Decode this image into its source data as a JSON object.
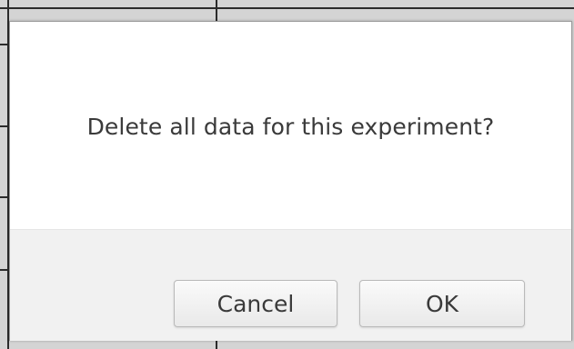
{
  "dialog": {
    "message": "Delete all data for this experiment?",
    "buttons": {
      "cancel_label": "Cancel",
      "ok_label": "OK"
    }
  },
  "colors": {
    "dialog_background": "#ffffff",
    "footer_background": "#f1f1f1",
    "text": "#3a3a3a",
    "button_border": "#b9b9b9",
    "background_grid": "#2b2b2b"
  }
}
